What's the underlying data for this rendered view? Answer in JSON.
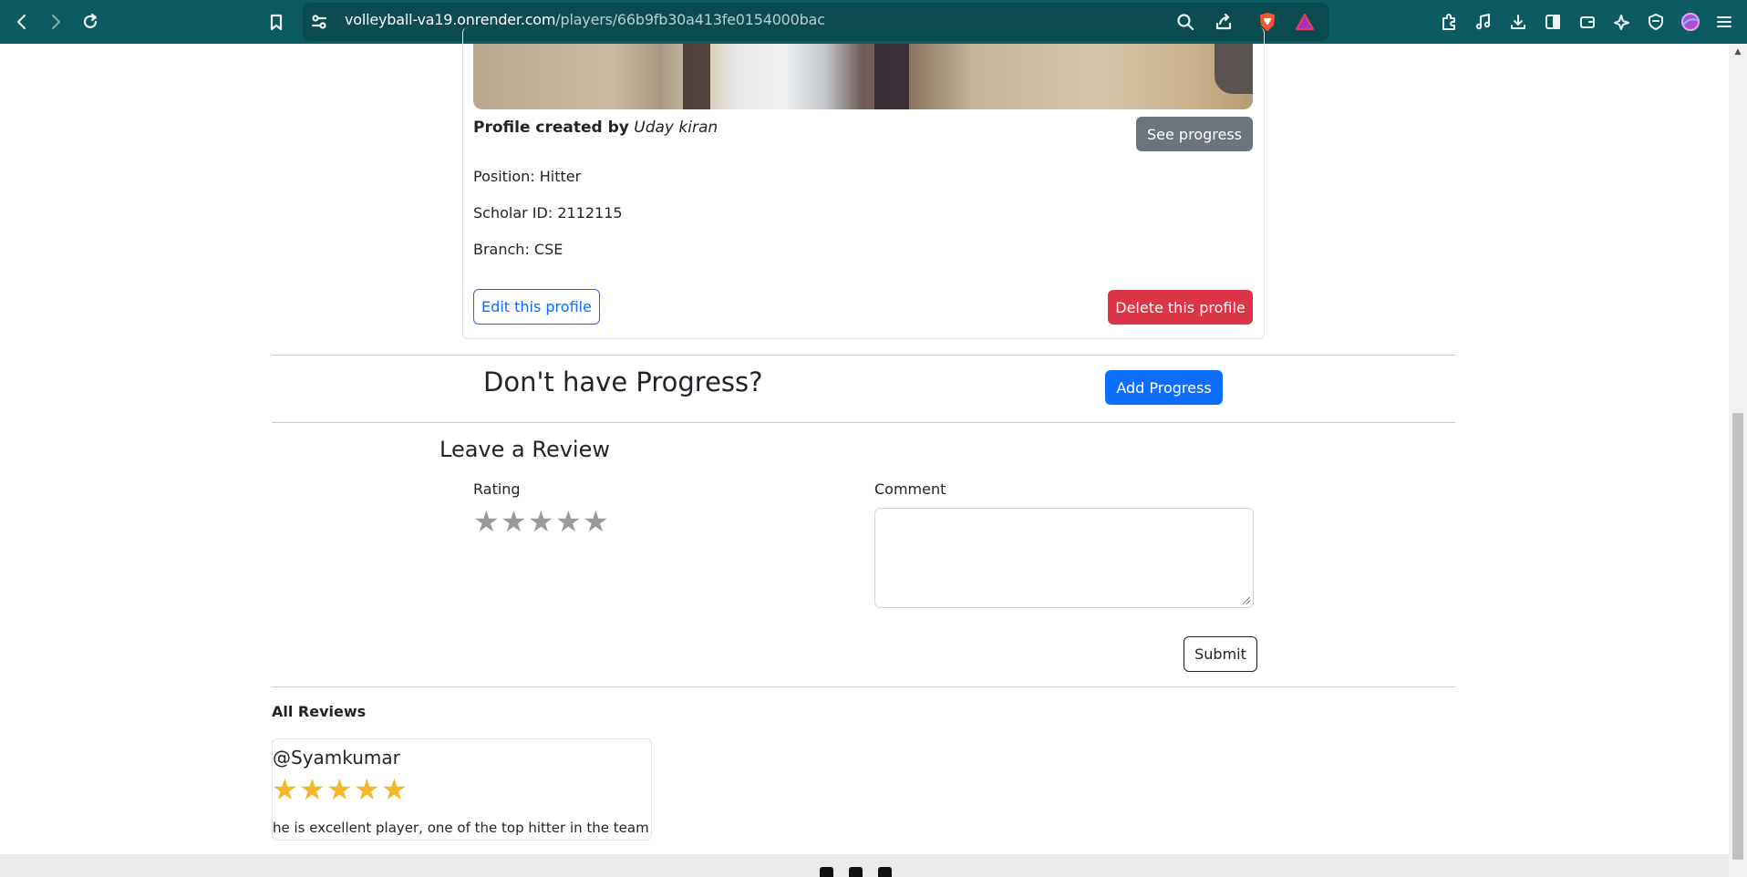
{
  "browser": {
    "url_host": "volleyball-va19.onrender.com",
    "url_path": "/players/66b9fb30a413fe0154000bac",
    "icons": [
      "back-icon",
      "forward-icon",
      "reload-icon",
      "bookmark-icon",
      "site-settings-icon",
      "zoom-icon",
      "share-icon",
      "brave-shields-icon",
      "brave-rewards-icon",
      "extensions-icon",
      "media-icon",
      "downloads-icon",
      "sidebar-icon",
      "wallet-icon",
      "leo-icon",
      "vpn-icon",
      "profile-icon",
      "menu-icon"
    ]
  },
  "profile": {
    "created_by_label": "Profile created by",
    "created_by_name": "Uday kiran",
    "see_progress_label": "See progress",
    "position": "Position: Hitter",
    "scholar_id": "Scholar ID: 2112115",
    "branch": "Branch: CSE",
    "edit_label": "Edit this profile",
    "delete_label": "Delete this profile"
  },
  "progress": {
    "heading": "Don't have Progress?",
    "add_label": "Add Progress"
  },
  "review_form": {
    "heading": "Leave a Review",
    "rating_label": "Rating",
    "rating_value": 0,
    "rating_max": 5,
    "comment_label": "Comment",
    "comment_value": "",
    "submit_label": "Submit"
  },
  "reviews": {
    "heading": "All Reviews",
    "items": [
      {
        "author": "@Syamkumar",
        "rating": 5,
        "body": "he is excellent player, one of the top hitter in the team"
      }
    ]
  },
  "colors": {
    "primary": "#0d6efd",
    "danger": "#dc3545",
    "secondary": "#6c757d",
    "star_filled": "#f4b62a",
    "star_empty": "#9a9a9a",
    "chrome": "#0c5b60"
  }
}
